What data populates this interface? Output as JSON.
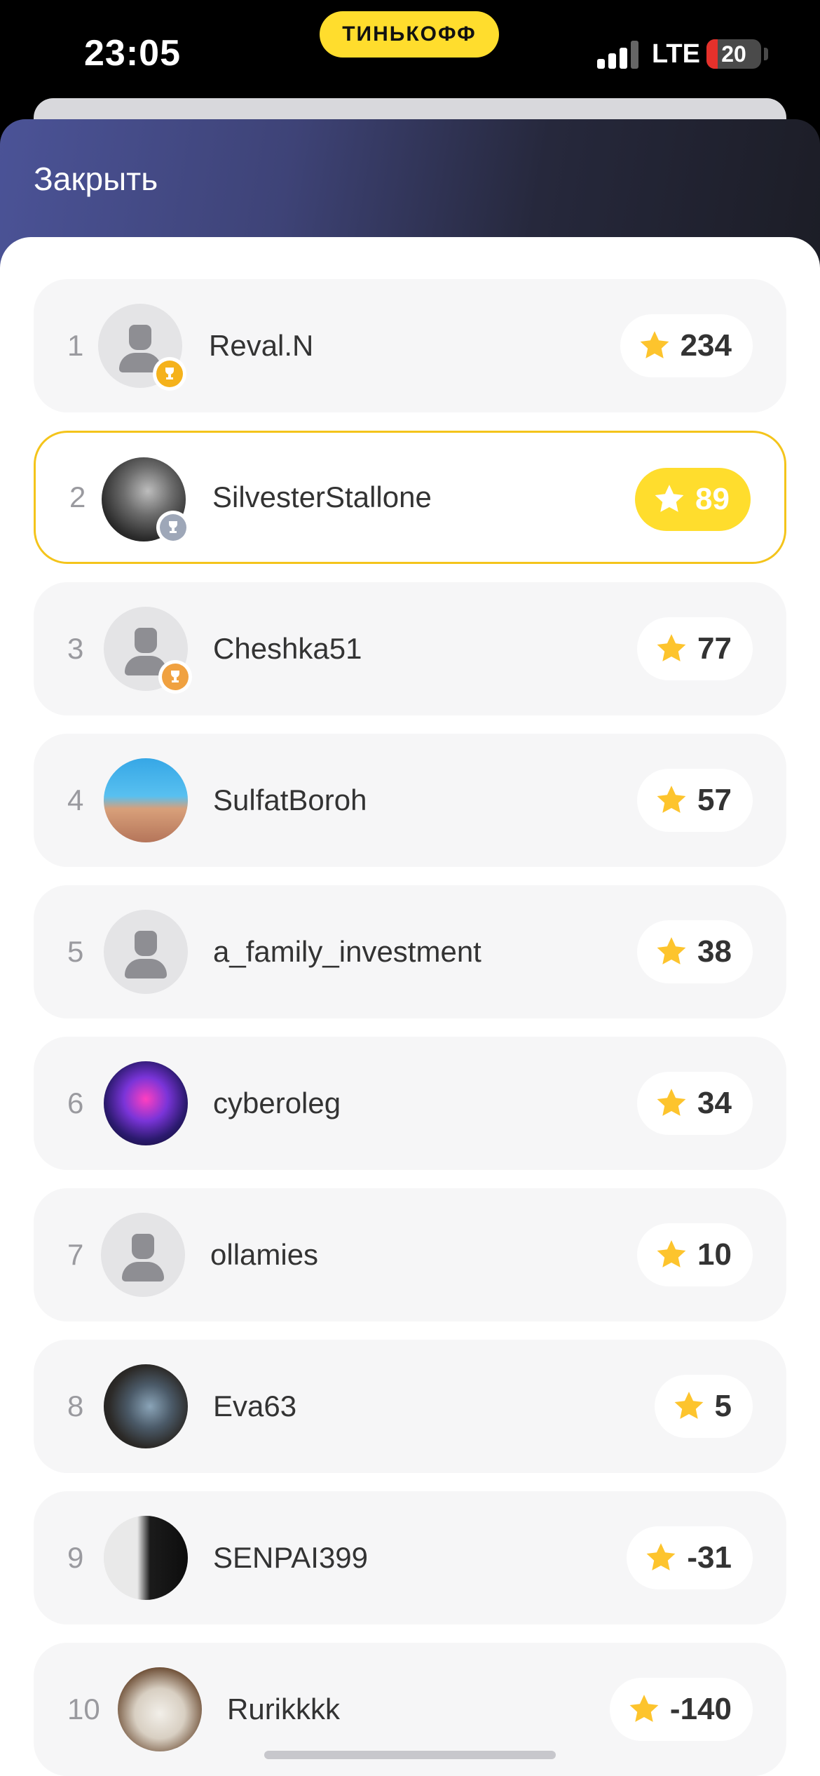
{
  "status_bar": {
    "time": "23:05",
    "brand": "ТИНЬКОФФ",
    "network": "LTE",
    "battery": "20"
  },
  "header": {
    "close_label": "Закрыть"
  },
  "colors": {
    "accent_yellow": "#ffdd2d",
    "highlight_border": "#f4c41b",
    "star": "#fdc42d",
    "gold_badge": "#f5b21b",
    "silver_badge": "#9ea7b8",
    "bronze_badge": "#f0a140"
  },
  "leaderboard": [
    {
      "rank": "1",
      "name": "Reval.N",
      "score": "234",
      "avatar": "default-user-icon",
      "badge": "gold-trophy-icon"
    },
    {
      "rank": "2",
      "name": "SilvesterStallone",
      "score": "89",
      "avatar": "photo-bw-man",
      "badge": "silver-trophy-icon",
      "current_user": true
    },
    {
      "rank": "3",
      "name": "Cheshka51",
      "score": "77",
      "avatar": "default-user-icon",
      "badge": "bronze-trophy-icon"
    },
    {
      "rank": "4",
      "name": "SulfatBoroh",
      "score": "57",
      "avatar": "photo-couple-pool"
    },
    {
      "rank": "5",
      "name": "a_family_investment",
      "score": "38",
      "avatar": "default-user-icon"
    },
    {
      "rank": "6",
      "name": "cyberoleg",
      "score": "34",
      "avatar": "photo-neon-raccoon"
    },
    {
      "rank": "7",
      "name": "ollamies",
      "score": "10",
      "avatar": "default-user-icon"
    },
    {
      "rank": "8",
      "name": "Eva63",
      "score": "5",
      "avatar": "photo-man-dark"
    },
    {
      "rank": "9",
      "name": "SENPAI399",
      "score": "-31",
      "avatar": "photo-silhouette"
    },
    {
      "rank": "10",
      "name": "Rurikkkk",
      "score": "-140",
      "avatar": "photo-cat"
    }
  ]
}
